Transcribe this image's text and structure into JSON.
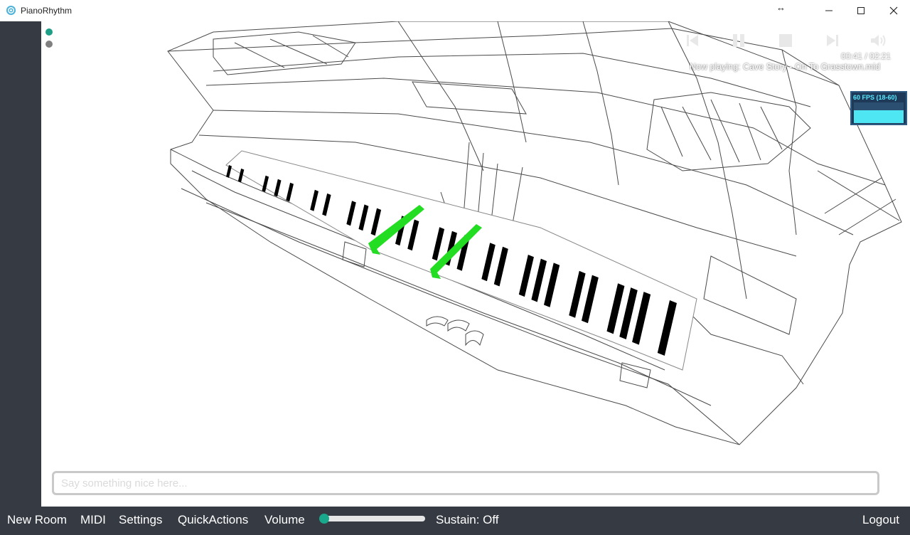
{
  "window": {
    "title": "PianoRhythm",
    "controls": [
      "minimize-icon",
      "maximize-icon",
      "close-icon"
    ]
  },
  "status_dots": [
    {
      "color": "#1e9e86"
    },
    {
      "color": "#808080"
    }
  ],
  "player": {
    "time": "00:41 / 02:21",
    "now_playing": "Now playing: Cave Story - On To Grasstown.mid",
    "buttons": [
      "previous-icon",
      "pause-icon",
      "stop-icon",
      "next-icon",
      "volume-icon"
    ]
  },
  "fps_meter": {
    "label": "60 FPS (18-60)"
  },
  "chat": {
    "placeholder": "Say something nice here..."
  },
  "bottom_bar": {
    "new_room": "New Room",
    "midi": "MIDI",
    "settings": "Settings",
    "quick_actions": "QuickActions",
    "volume": "Volume",
    "volume_level": 0.0,
    "sustain": "Sustain: Off",
    "logout": "Logout"
  },
  "colors": {
    "accent": "#1aa88c",
    "bar_bg": "#363a43",
    "pressed_key": "#22dd22",
    "wireframe": "#4a4a4a"
  }
}
